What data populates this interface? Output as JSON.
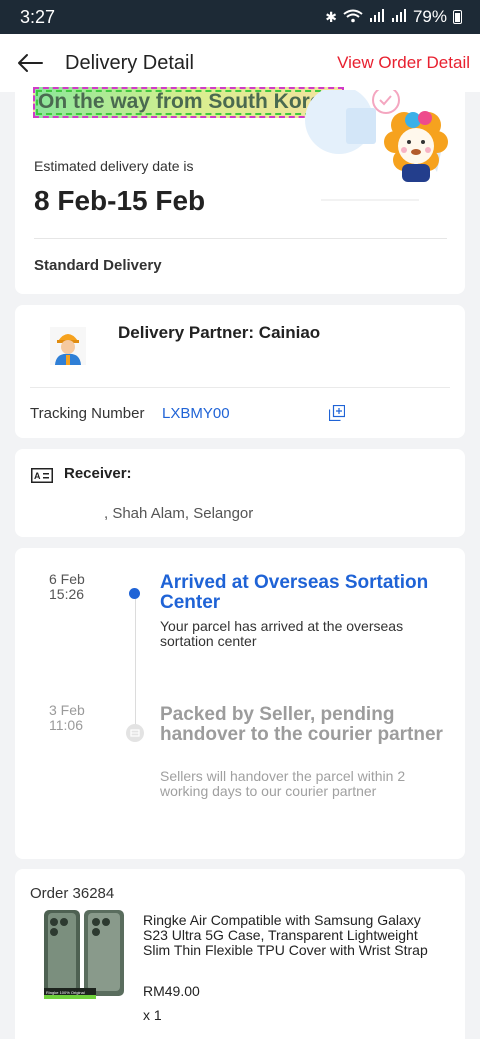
{
  "status_bar": {
    "time": "3:27",
    "battery": "79%",
    "icons": [
      "bluetooth-icon",
      "wifi-calling-icon",
      "signal-icon",
      "battery-icon"
    ]
  },
  "header": {
    "title": "Delivery Detail",
    "view_order": "View Order Detail"
  },
  "delivery": {
    "headline": "On the way from South Korea!",
    "estimate_label": "Estimated delivery date is",
    "estimate_date": "8 Feb-15 Feb",
    "method": "Standard Delivery"
  },
  "partner": {
    "label": "Delivery Partner: Cainiao",
    "tracking_label": "Tracking Number",
    "tracking_number": "LXBMY00"
  },
  "receiver": {
    "label": "Receiver:",
    "address": ", Shah Alam, Selangor"
  },
  "timeline": [
    {
      "date": "6 Feb",
      "time": "15:26",
      "title": "Arrived at Overseas Sortation Center",
      "desc": "Your parcel has arrived at the overseas sortation center",
      "active": true
    },
    {
      "date": "3 Feb",
      "time": "11:06",
      "title": "Packed by Seller, pending handover to the courier partner",
      "desc": "Sellers will handover the parcel within 2 working days to our courier partner",
      "active": false
    }
  ],
  "order": {
    "label": "Order 36284",
    "product_name": "Ringke Air Compatible with Samsung Galaxy S23 Ultra 5G Case, Transparent Lightweight Slim Thin Flexible TPU Cover with Wrist Strap",
    "price": "RM49.00",
    "quantity": "x 1",
    "image_text": "Ringke  100% Original"
  },
  "colors": {
    "accent_red": "#e8202f",
    "accent_blue": "#1f63d6",
    "status_bar_bg": "#1d2a36"
  }
}
